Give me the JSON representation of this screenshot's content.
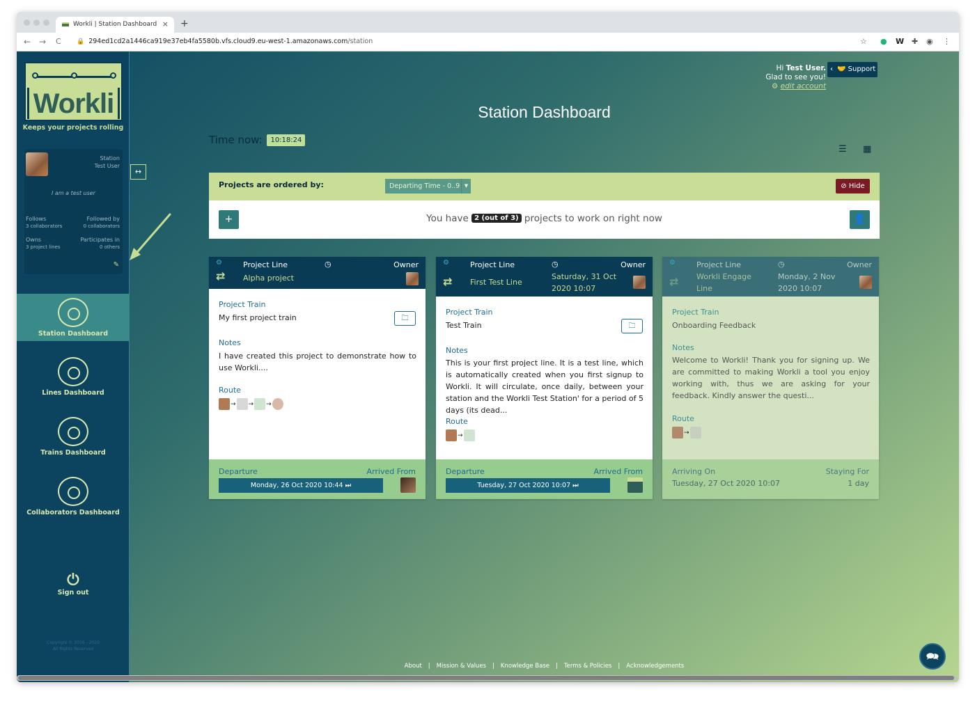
{
  "browser": {
    "tab_title": "Workli | Station Dashboard",
    "tab_close": "×",
    "new_tab": "+",
    "nav_back": "←",
    "nav_forward": "→",
    "nav_reload": "C",
    "url_host": "294ed1cd2a1446ca919e37eb4fa5580b.vfs.cloud9.eu-west-1.amazonaws.com",
    "url_path": "/station"
  },
  "sidebar": {
    "logo_text": "Workli",
    "tagline": "Keeps your projects rolling",
    "role": "Station",
    "user_name": "Test User",
    "bio": "I am a test user",
    "follows_label": "Follows",
    "follows_value": "3 collaborators",
    "followed_by_label": "Followed by",
    "followed_by_value": "0 collaborators",
    "owns_label": "Owns",
    "owns_value": "3 project lines",
    "participates_label": "Participates in",
    "participates_value": "0 others",
    "toggle": "↔",
    "items": [
      {
        "label": "Station Dashboard"
      },
      {
        "label": "Lines Dashboard"
      },
      {
        "label": "Trains Dashboard"
      },
      {
        "label": "Collaborators Dashboard"
      }
    ],
    "signout_label": "Sign out",
    "copyright_line1": "Copyright © 2016 - 2020",
    "copyright_line2": "All Rights Reserved"
  },
  "header": {
    "greeting_prefix": "Hi",
    "greeting_name": "Test User.",
    "greeting_line2": "Glad to see you!",
    "edit_account": "edit account",
    "support_label": "Support",
    "page_title": "Station Dashboard",
    "time_label": "Time now:",
    "time_value": "10:18:24"
  },
  "order_bar": {
    "label": "Projects are ordered by:",
    "selected": "Departing Time - 0..9",
    "hide_label": "Hide"
  },
  "summary": {
    "prefix": "You have",
    "count": "2 (out of 3)",
    "suffix": "projects to work on right now",
    "add_label": "+"
  },
  "card_labels": {
    "project_line": "Project Line",
    "owner": "Owner",
    "project_train": "Project Train",
    "notes": "Notes",
    "route": "Route",
    "departure": "Departure",
    "arrived_from": "Arrived From",
    "arriving_on": "Arriving On",
    "staying_for": "Staying For"
  },
  "cards": [
    {
      "line_name": "Alpha project",
      "deadline": "",
      "train": "My first project train",
      "notes": "I have created this project to demonstrate how to use Workli....",
      "departure": "Monday, 26 Oct 2020 10:44 ⏭"
    },
    {
      "line_name": "First Test Line",
      "deadline": "Saturday, 31 Oct 2020 10:07",
      "train": "Test Train",
      "notes": "This is your first project line. It is a test line, which is automatically created when you first signup to Workli. It will circulate, once daily, between your station and the Workli Test Station' for a period of 5 days (its dead...",
      "departure": "Tuesday, 27 Oct 2020 10:07 ⏭"
    },
    {
      "line_name": "Workli Engage Line",
      "deadline": "Monday, 2 Nov 2020 10:07",
      "train": "Onboarding Feedback",
      "notes": "Welcome to Workli! Thank you for signing up. We are committed to making Workli a tool you enjoy working with, thus we are asking for your feedback. Kindly answer the questi...",
      "arriving_on": "Tuesday, 27 Oct 2020 10:07",
      "staying_for": "1 day"
    }
  ],
  "footer": {
    "links": [
      "About",
      "Mission & Values",
      "Knowledge Base",
      "Terms & Policies",
      "Acknowledgements"
    ]
  },
  "colors": {
    "sidebar": "#0c4460",
    "accent": "#c8dd95",
    "card_header": "#0a3b54",
    "card_footer": "#96cc8e",
    "hide_button": "#7a1a25"
  }
}
